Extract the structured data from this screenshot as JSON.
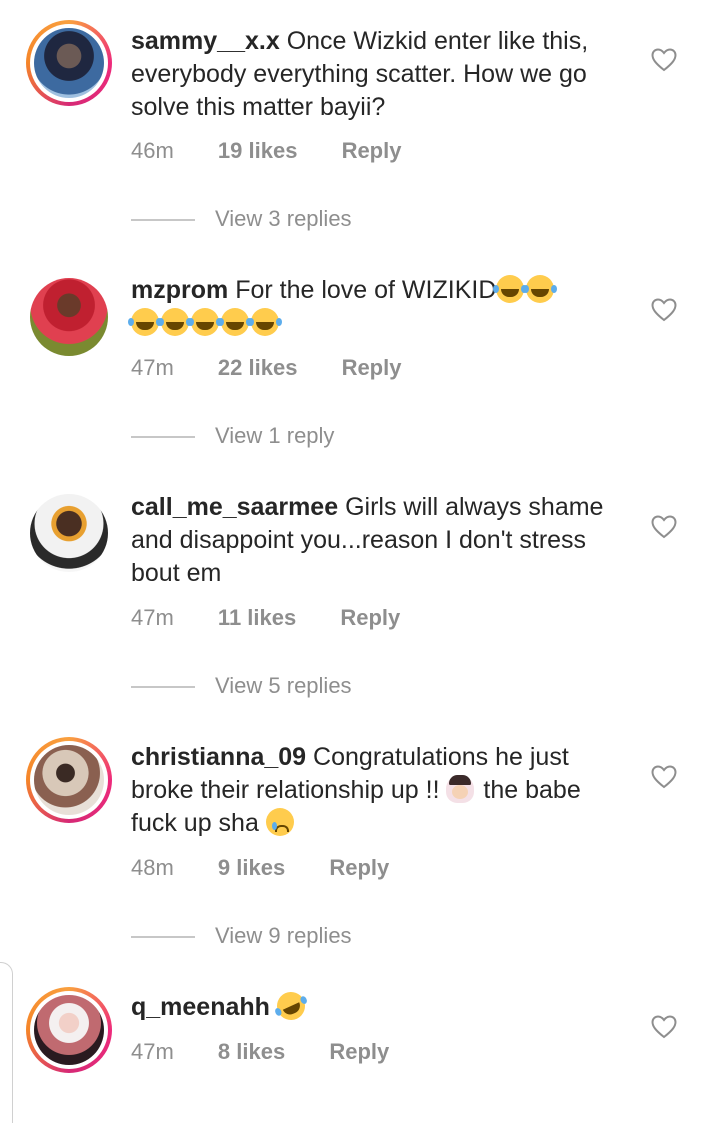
{
  "comments": [
    {
      "username": "sammy__x.x",
      "text": "Once Wizkid enter like this, everybody everything scatter. How we go solve this matter bayii?",
      "time": "46m",
      "likes": "19 likes",
      "reply": "Reply",
      "view_replies": "View 3 replies",
      "has_story": true,
      "emojis": []
    },
    {
      "username": "mzprom",
      "text": "For the love of WIZIKID",
      "time": "47m",
      "likes": "22 likes",
      "reply": "Reply",
      "view_replies": "View 1 reply",
      "has_story": false,
      "emojis": [
        "face-with-tears-of-joy",
        "face-with-tears-of-joy",
        "face-with-tears-of-joy",
        "face-with-tears-of-joy",
        "face-with-tears-of-joy",
        "face-with-tears-of-joy",
        "face-with-tears-of-joy"
      ]
    },
    {
      "username": "call_me_saarmee",
      "text": "Girls will always shame and disappoint you...reason I don't stress bout em",
      "time": "47m",
      "likes": "11 likes",
      "reply": "Reply",
      "view_replies": "View 5 replies",
      "has_story": false,
      "emojis": []
    },
    {
      "username": "christianna_09",
      "text_1": "Congratulations he just broke their relationship up !!",
      "text_2": "the babe fuck up sha",
      "time": "48m",
      "likes": "9 likes",
      "reply": "Reply",
      "view_replies": "View 9 replies",
      "has_story": true,
      "emojis": [
        "facepalm",
        "crying-face"
      ]
    },
    {
      "username": "q_meenahh",
      "text": "",
      "time": "47m",
      "likes": "8 likes",
      "reply": "Reply",
      "has_story": true,
      "emojis": [
        "rolling-on-floor-laughing"
      ]
    }
  ],
  "colors": {
    "text": "#262626",
    "secondary": "#8e8e8e",
    "story_ring_start": "#f9a03f",
    "story_ring_end": "#d62976",
    "emoji_yellow": "#ffcc4d"
  }
}
